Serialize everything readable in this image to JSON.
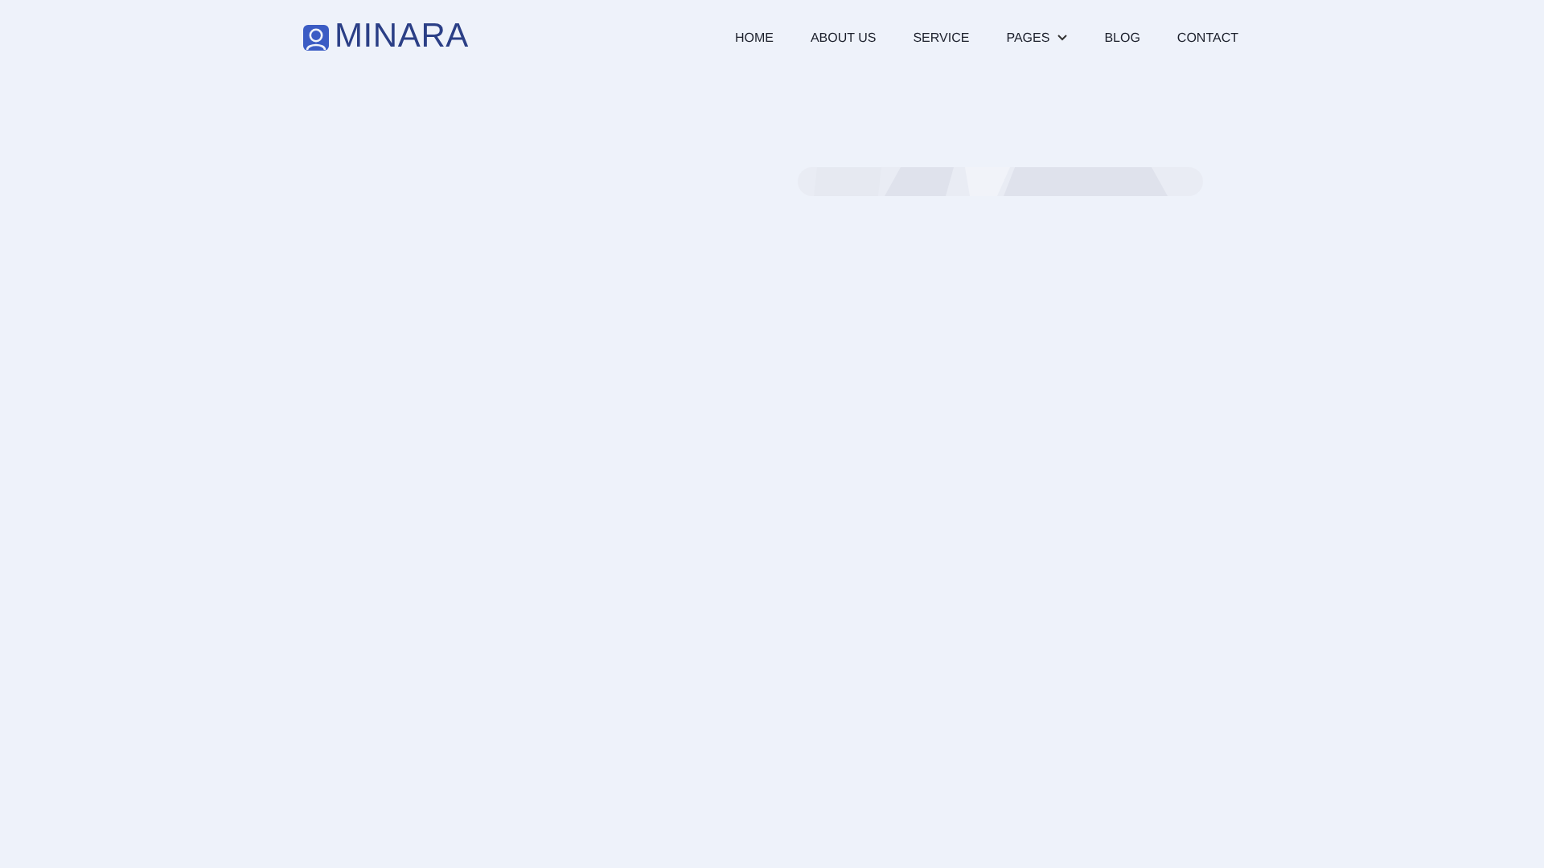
{
  "header": {
    "logo": {
      "text": "MINARA"
    },
    "nav": [
      {
        "label": "HOME",
        "dropdown": false
      },
      {
        "label": "ABOUT US",
        "dropdown": false
      },
      {
        "label": "SERVICE",
        "dropdown": false
      },
      {
        "label": "PAGES",
        "dropdown": true
      },
      {
        "label": "BLOG",
        "dropdown": false
      },
      {
        "label": "CONTACT",
        "dropdown": false
      }
    ]
  }
}
